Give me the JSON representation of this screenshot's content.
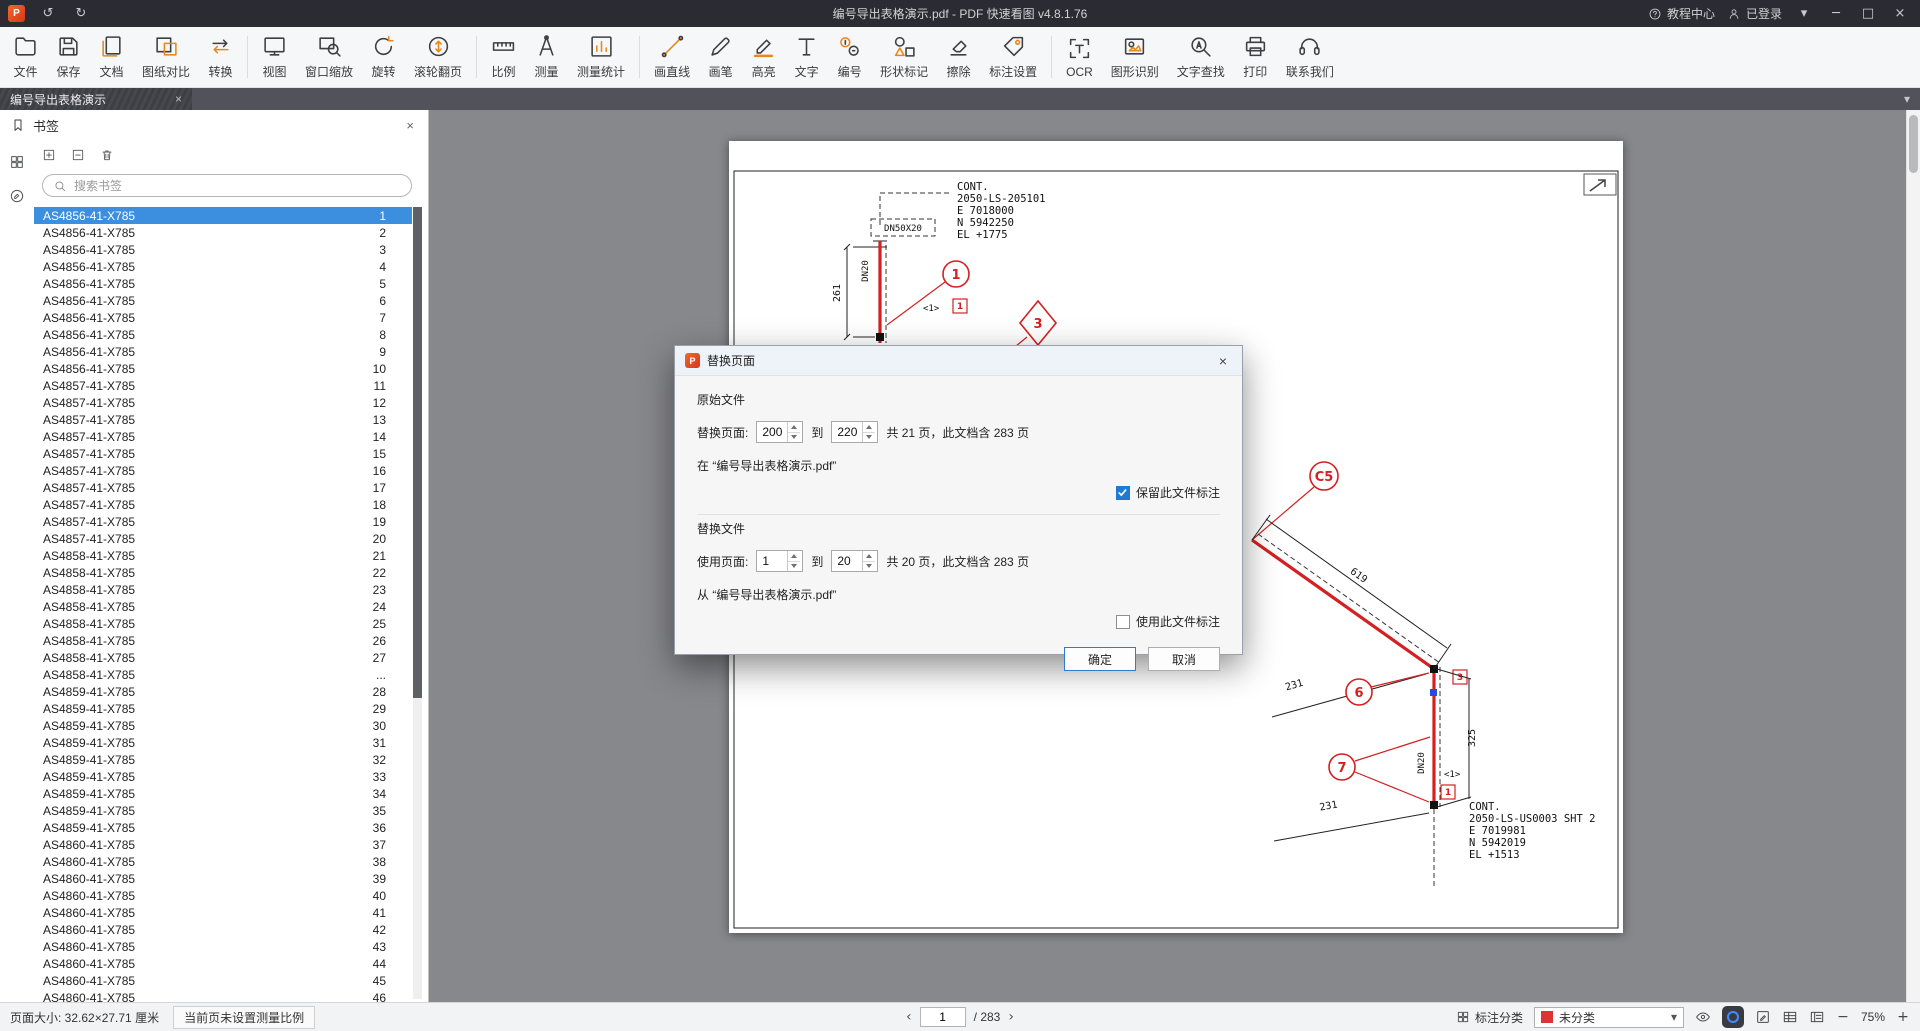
{
  "titlebar": {
    "title": "编号导出表格演示.pdf - PDF 快速看图 v4.8.1.76",
    "undo": "↺",
    "redo": "↻",
    "help": "教程中心",
    "login": "已登录",
    "chevron": "▾",
    "minimize": "─",
    "maximize": "□",
    "close": "×"
  },
  "toolbar": {
    "items": [
      {
        "label": "文件",
        "icon": "file"
      },
      {
        "label": "保存",
        "icon": "save"
      },
      {
        "label": "文档",
        "icon": "docs"
      },
      {
        "label": "图纸对比",
        "icon": "compare"
      },
      {
        "label": "转换",
        "icon": "convert",
        "group_end": true
      },
      {
        "label": "视图",
        "icon": "view"
      },
      {
        "label": "窗口缩放",
        "icon": "zoom-window"
      },
      {
        "label": "旋转",
        "icon": "rotate"
      },
      {
        "label": "滚轮翻页",
        "icon": "scroll-flip",
        "group_end": true
      },
      {
        "label": "比例",
        "icon": "ruler"
      },
      {
        "label": "测量",
        "icon": "measure"
      },
      {
        "label": "测量统计",
        "icon": "stats",
        "group_end": true
      },
      {
        "label": "画直线",
        "icon": "line"
      },
      {
        "label": "画笔",
        "icon": "pen"
      },
      {
        "label": "高亮",
        "icon": "highlight"
      },
      {
        "label": "文字",
        "icon": "text"
      },
      {
        "label": "编号",
        "icon": "number"
      },
      {
        "label": "形状标记",
        "icon": "shapes"
      },
      {
        "label": "擦除",
        "icon": "erase"
      },
      {
        "label": "标注设置",
        "icon": "annot-settings",
        "group_end": true
      },
      {
        "label": "OCR",
        "icon": "ocr"
      },
      {
        "label": "图形识别",
        "icon": "shape-recog"
      },
      {
        "label": "文字查找",
        "icon": "find-text"
      },
      {
        "label": "打印",
        "icon": "print"
      },
      {
        "label": "联系我们",
        "icon": "contact"
      }
    ]
  },
  "tabbar": {
    "active_tab": "编号导出表格演示",
    "close_glyph": "×",
    "overflow_glyph": "▾"
  },
  "sidebar": {
    "panel_title": "书签",
    "close_glyph": "×",
    "search_placeholder": "搜索书签",
    "selected_index": 0,
    "bookmarks": [
      {
        "label": "AS4856-41-X785",
        "page": "1"
      },
      {
        "label": "AS4856-41-X785",
        "page": "2"
      },
      {
        "label": "AS4856-41-X785",
        "page": "3"
      },
      {
        "label": "AS4856-41-X785",
        "page": "4"
      },
      {
        "label": "AS4856-41-X785",
        "page": "5"
      },
      {
        "label": "AS4856-41-X785",
        "page": "6"
      },
      {
        "label": "AS4856-41-X785",
        "page": "7"
      },
      {
        "label": "AS4856-41-X785",
        "page": "8"
      },
      {
        "label": "AS4856-41-X785",
        "page": "9"
      },
      {
        "label": "AS4856-41-X785",
        "page": "10"
      },
      {
        "label": "AS4857-41-X785",
        "page": "11"
      },
      {
        "label": "AS4857-41-X785",
        "page": "12"
      },
      {
        "label": "AS4857-41-X785",
        "page": "13"
      },
      {
        "label": "AS4857-41-X785",
        "page": "14"
      },
      {
        "label": "AS4857-41-X785",
        "page": "15"
      },
      {
        "label": "AS4857-41-X785",
        "page": "16"
      },
      {
        "label": "AS4857-41-X785",
        "page": "17"
      },
      {
        "label": "AS4857-41-X785",
        "page": "18"
      },
      {
        "label": "AS4857-41-X785",
        "page": "19"
      },
      {
        "label": "AS4857-41-X785",
        "page": "20"
      },
      {
        "label": "AS4858-41-X785",
        "page": "21"
      },
      {
        "label": "AS4858-41-X785",
        "page": "22"
      },
      {
        "label": "AS4858-41-X785",
        "page": "23"
      },
      {
        "label": "AS4858-41-X785",
        "page": "24"
      },
      {
        "label": "AS4858-41-X785",
        "page": "25"
      },
      {
        "label": "AS4858-41-X785",
        "page": "26"
      },
      {
        "label": "AS4858-41-X785",
        "page": "27"
      },
      {
        "label": "AS4858-41-X785",
        "page": "..."
      },
      {
        "label": "AS4859-41-X785",
        "page": "28"
      },
      {
        "label": "AS4859-41-X785",
        "page": "29"
      },
      {
        "label": "AS4859-41-X785",
        "page": "30"
      },
      {
        "label": "AS4859-41-X785",
        "page": "31"
      },
      {
        "label": "AS4859-41-X785",
        "page": "32"
      },
      {
        "label": "AS4859-41-X785",
        "page": "33"
      },
      {
        "label": "AS4859-41-X785",
        "page": "34"
      },
      {
        "label": "AS4859-41-X785",
        "page": "35"
      },
      {
        "label": "AS4859-41-X785",
        "page": "36"
      },
      {
        "label": "AS4860-41-X785",
        "page": "37"
      },
      {
        "label": "AS4860-41-X785",
        "page": "38"
      },
      {
        "label": "AS4860-41-X785",
        "page": "39"
      },
      {
        "label": "AS4860-41-X785",
        "page": "40"
      },
      {
        "label": "AS4860-41-X785",
        "page": "41"
      },
      {
        "label": "AS4860-41-X785",
        "page": "42"
      },
      {
        "label": "AS4860-41-X785",
        "page": "43"
      },
      {
        "label": "AS4860-41-X785",
        "page": "44"
      },
      {
        "label": "AS4860-41-X785",
        "page": "45"
      },
      {
        "label": "AS4860-41-X785",
        "page": "46"
      }
    ]
  },
  "dialog": {
    "title": "替换页面",
    "close_glyph": "×",
    "section_original": "原始文件",
    "replace_pages_label": "替换页面:",
    "to_label": "到",
    "orig_from": "200",
    "orig_to": "220",
    "orig_info": "共 21 页，此文档含 283 页",
    "orig_file": "在 “编号导出表格演示.pdf”",
    "keep_annot_label": "保留此文件标注",
    "section_replace": "替换文件",
    "use_pages_label": "使用页面:",
    "use_from": "1",
    "use_to": "20",
    "use_info": "共 20 页，此文档含 283 页",
    "use_file": "从 “编号导出表格演示.pdf”",
    "use_annot_label": "使用此文件标注",
    "ok_label": "确定",
    "cancel_label": "取消"
  },
  "statusbar": {
    "page_size": "页面大小: 32.62×27.71 厘米",
    "scale_hint": "当前页未设置测量比例",
    "prev_glyph": "‹",
    "next_glyph": "›",
    "current_page": "1",
    "page_total": "/ 283",
    "annot_category_label": "标注分类",
    "category_value": "未分类",
    "category_color": "#e03232",
    "caret_glyph": "▾",
    "zoom_out": "−",
    "zoom_value": "75%",
    "zoom_in": "+"
  },
  "drawing": {
    "cont_top": [
      "CONT.",
      "2050-LS-205101",
      "E 7018000",
      "N 5942250",
      "EL +1775"
    ],
    "cont_bottom": [
      "CONT.",
      "2050-LS-US0003 SHT 2",
      "E 7019981",
      "N 5942019",
      "EL +1513"
    ],
    "dn_label": "DN50X20",
    "pipe_label_top": "DN20",
    "pipe_label_bottom": "DN20",
    "dim_261": "261",
    "dim_619": "619",
    "dim_231_a": "231",
    "dim_325": "325",
    "dim_231_b": "231",
    "balloon_1": "1",
    "balloon_3": "3",
    "balloon_c5": "C5",
    "balloon_6": "6",
    "balloon_7": "7",
    "ref_box_1a": "1",
    "ref_box_3": "3",
    "ref_box_1b": "1",
    "note_1a": "<1>",
    "note_1b": "<1>"
  }
}
